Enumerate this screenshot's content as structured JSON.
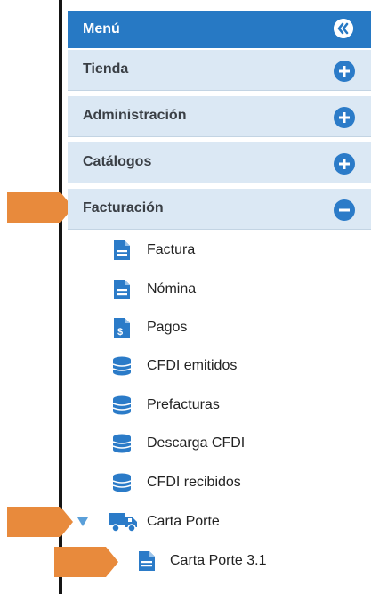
{
  "menu": {
    "title": "Menú"
  },
  "sections": {
    "tienda": "Tienda",
    "administracion": "Administración",
    "catalogos": "Catálogos",
    "facturacion": "Facturación"
  },
  "facturacion_items": {
    "factura": "Factura",
    "nomina": "Nómina",
    "pagos": "Pagos",
    "cfdi_emitidos": "CFDI emitidos",
    "prefacturas": "Prefacturas",
    "descarga_cfdi": "Descarga CFDI",
    "cfdi_recibidos": "CFDI recibidos"
  },
  "carta_porte": {
    "label": "Carta Porte",
    "child": "Carta Porte 3.1"
  },
  "colors": {
    "header_bg": "#2779c4",
    "section_bg": "#dbe8f4",
    "icon_blue": "#2b7bc8",
    "pointer_orange": "#e88a3c"
  },
  "icons": {
    "collapse": "double-chevron-left-icon",
    "expand": "plus-circle-icon",
    "collapse_section": "minus-circle-icon",
    "document": "document-icon",
    "payment": "dollar-document-icon",
    "database": "database-icon",
    "truck": "truck-icon",
    "tree_arrow": "triangle-down-icon"
  }
}
